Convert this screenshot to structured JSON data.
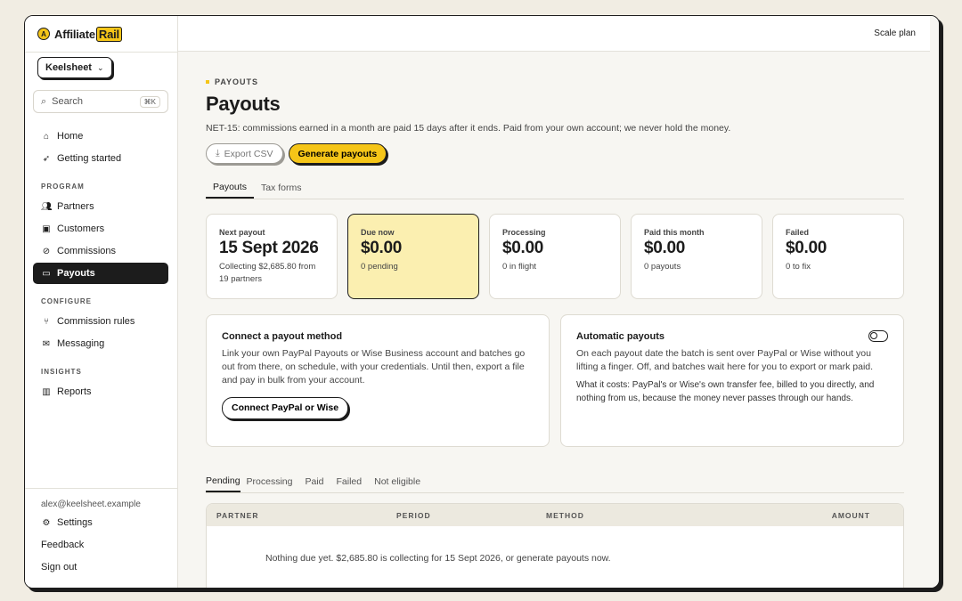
{
  "brand": {
    "name_prefix": "Affiliate",
    "name_suffix": "Rail",
    "mark": "A"
  },
  "workspace": {
    "name": "Keelsheet"
  },
  "search": {
    "label": "Search",
    "shortcut": "⌘K"
  },
  "nav": {
    "top": [
      {
        "label": "Home",
        "icon": "home-icon"
      },
      {
        "label": "Getting started",
        "icon": "rocket-icon"
      }
    ],
    "program_heading": "PROGRAM",
    "program": [
      {
        "label": "Partners",
        "icon": "users-icon"
      },
      {
        "label": "Customers",
        "icon": "contact-card-icon"
      },
      {
        "label": "Commissions",
        "icon": "percent-icon"
      },
      {
        "label": "Payouts",
        "icon": "payout-icon",
        "active": true
      }
    ],
    "configure_heading": "CONFIGURE",
    "configure": [
      {
        "label": "Commission rules",
        "icon": "branch-icon"
      },
      {
        "label": "Messaging",
        "icon": "mail-icon"
      }
    ],
    "insights_heading": "INSIGHTS",
    "insights": [
      {
        "label": "Reports",
        "icon": "bar-chart-icon"
      }
    ]
  },
  "footer": {
    "email": "alex@keelsheet.example",
    "settings": "Settings",
    "feedback": "Feedback",
    "sign_out": "Sign out"
  },
  "topbar": {
    "plan": "Scale plan"
  },
  "page": {
    "eyebrow": "PAYOUTS",
    "title": "Payouts",
    "subtitle": "NET-15: commissions earned in a month are paid 15 days after it ends. Paid from your own account; we never hold the money.",
    "export_label": "Export CSV",
    "generate_label": "Generate payouts",
    "tabs": [
      "Payouts",
      "Tax forms"
    ]
  },
  "stats": [
    {
      "label": "Next payout",
      "value": "15 Sept 2026",
      "sub": "Collecting $2,685.80 from 19 partners"
    },
    {
      "label": "Due now",
      "value": "$0.00",
      "sub": "0 pending"
    },
    {
      "label": "Processing",
      "value": "$0.00",
      "sub": "0 in flight"
    },
    {
      "label": "Paid this month",
      "value": "$0.00",
      "sub": "0 payouts"
    },
    {
      "label": "Failed",
      "value": "$0.00",
      "sub": "0 to fix"
    }
  ],
  "connect_card": {
    "title": "Connect a payout method",
    "body": "Link your own PayPal Payouts or Wise Business account and batches go out from there, on schedule, with your credentials. Until then, export a file and pay in bulk from your account.",
    "button": "Connect PayPal or Wise"
  },
  "auto_card": {
    "title": "Automatic payouts",
    "body": "On each payout date the batch is sent over PayPal or Wise without you lifting a finger. Off, and batches wait here for you to export or mark paid.",
    "cost": "What it costs: PayPal's or Wise's own transfer fee, billed to you directly, and nothing from us, because the money never passes through our hands.",
    "toggle_on": false
  },
  "list_tabs": [
    "Pending",
    "Processing",
    "Paid",
    "Failed",
    "Not eligible"
  ],
  "table": {
    "columns": [
      "PARTNER",
      "PERIOD",
      "METHOD",
      "AMOUNT"
    ],
    "empty": "Nothing due yet. $2,685.80 is collecting for 15 Sept 2026, or generate payouts now."
  },
  "colors": {
    "accent": "#f5c518",
    "highlight": "#fbefb0",
    "ink": "#1c1c1c"
  }
}
